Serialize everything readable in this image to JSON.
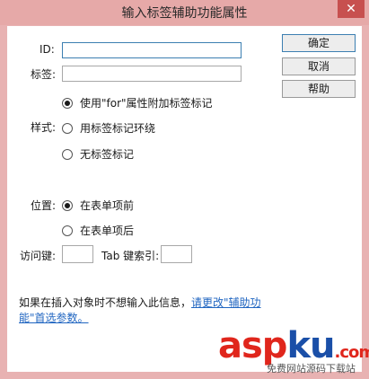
{
  "window": {
    "title": "输入标签辅助功能属性",
    "close_glyph": "✕"
  },
  "form": {
    "id_label": "ID:",
    "id_value": "",
    "tag_label": "标签:",
    "tag_value": "",
    "style_label": "样式:",
    "style_options": [
      "使用\"for\"属性附加标签标记",
      "用标签标记环绕",
      "无标签标记"
    ],
    "style_selected": 0,
    "position_label": "位置:",
    "position_options": [
      "在表单项前",
      "在表单项后"
    ],
    "position_selected": 0,
    "access_key_label": "访问键:",
    "access_key_value": "",
    "tab_index_label": "Tab 键索引:",
    "tab_index_value": ""
  },
  "buttons": {
    "ok": "确定",
    "cancel": "取消",
    "help": "帮助"
  },
  "note": {
    "prefix": "如果在插入对象时不想输入此信息，",
    "link": "请更改\"辅助功能\"首选参数。"
  },
  "watermark": {
    "text_a": "asp",
    "text_b": "ku",
    "text_c": ".com",
    "sub": "免费网站源码下载站",
    "color_a": "#e0261c",
    "color_b": "#1a4fa8"
  }
}
